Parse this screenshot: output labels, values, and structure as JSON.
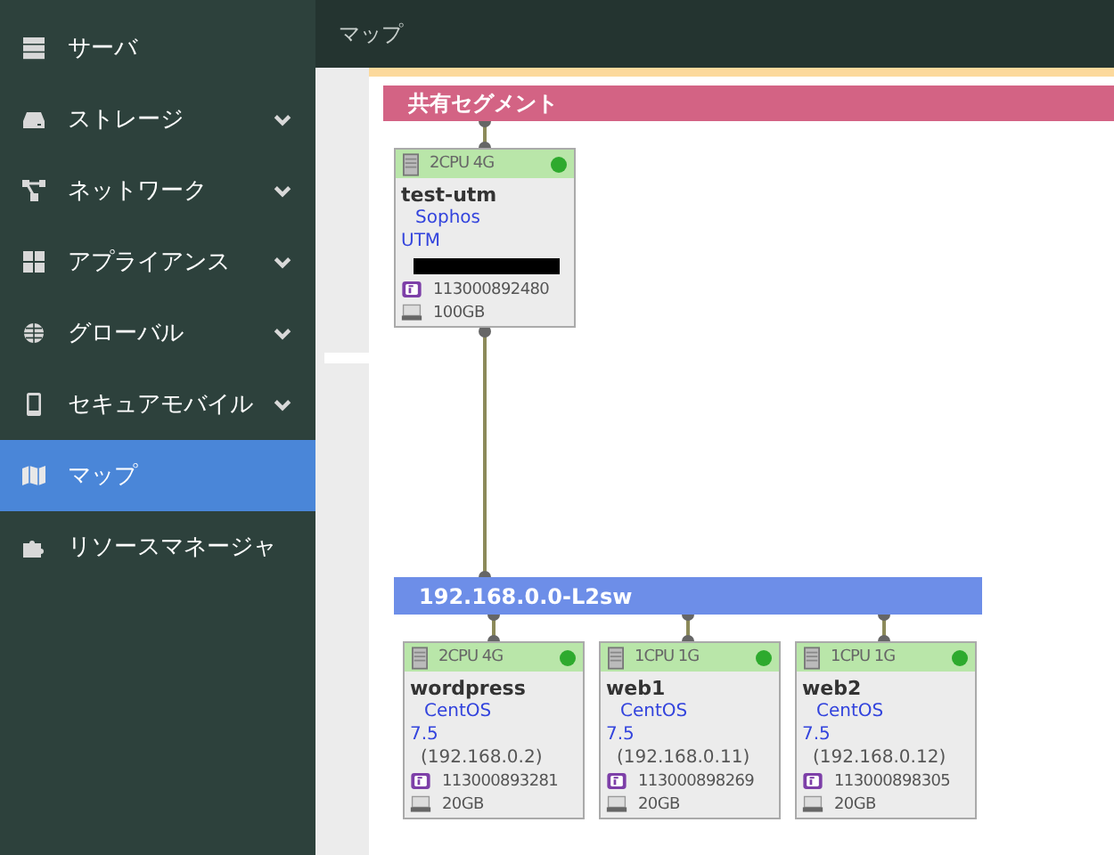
{
  "sidebar": {
    "items": [
      {
        "kind": "server",
        "label": "サーバ",
        "expandable": false,
        "selected": false
      },
      {
        "kind": "storage",
        "label": "ストレージ",
        "expandable": true,
        "selected": false
      },
      {
        "kind": "network",
        "label": "ネットワーク",
        "expandable": true,
        "selected": false
      },
      {
        "kind": "appliance",
        "label": "アプライアンス",
        "expandable": true,
        "selected": false
      },
      {
        "kind": "global",
        "label": "グローバル",
        "expandable": true,
        "selected": false
      },
      {
        "kind": "mobile",
        "label": "セキュアモバイル",
        "expandable": true,
        "selected": false
      },
      {
        "kind": "map",
        "label": "マップ",
        "expandable": false,
        "selected": true
      },
      {
        "kind": "resource",
        "label": "リソースマネージャ",
        "expandable": false,
        "selected": false
      }
    ]
  },
  "header": {
    "title": "マップ"
  },
  "map": {
    "segments": [
      {
        "name": "共有セグメント",
        "color": "#d36384"
      },
      {
        "name": "192.168.0.0-L2sw",
        "color": "#6d8ee8"
      }
    ],
    "nodes": [
      {
        "spec": "2CPU 4G",
        "running": true,
        "name": "test-utm",
        "os": "Sophos UTM",
        "redacted": true,
        "id": "113000892480",
        "disk": "100GB"
      },
      {
        "spec": "2CPU 4G",
        "running": true,
        "name": "wordpress",
        "os": "CentOS 7.5",
        "ip": "(192.168.0.2)",
        "id": "113000893281",
        "disk": "20GB"
      },
      {
        "spec": "1CPU 1G",
        "running": true,
        "name": "web1",
        "os": "CentOS 7.5",
        "ip": "(192.168.0.11)",
        "id": "113000898269",
        "disk": "20GB"
      },
      {
        "spec": "1CPU 1G",
        "running": true,
        "name": "web2",
        "os": "CentOS 7.5",
        "ip": "(192.168.0.12)",
        "id": "113000898305",
        "disk": "20GB"
      }
    ]
  }
}
